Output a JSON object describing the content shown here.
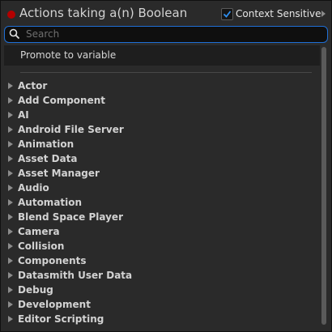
{
  "header": {
    "title": "Actions taking a(n) Boolean",
    "pin_color": "#b30000",
    "context_sensitive": {
      "label": "Context Sensitive",
      "checked": true
    }
  },
  "search": {
    "placeholder": "Search",
    "value": ""
  },
  "list": {
    "promote_label": "Promote to variable",
    "categories": [
      "Actor",
      "Add Component",
      "AI",
      "Android File Server",
      "Animation",
      "Asset Data",
      "Asset Manager",
      "Audio",
      "Automation",
      "Blend Space Player",
      "Camera",
      "Collision",
      "Components",
      "Datasmith User Data",
      "Debug",
      "Development",
      "Editor Scripting"
    ]
  },
  "colors": {
    "accent": "#1f6fd6",
    "background": "#2a2a2a"
  }
}
